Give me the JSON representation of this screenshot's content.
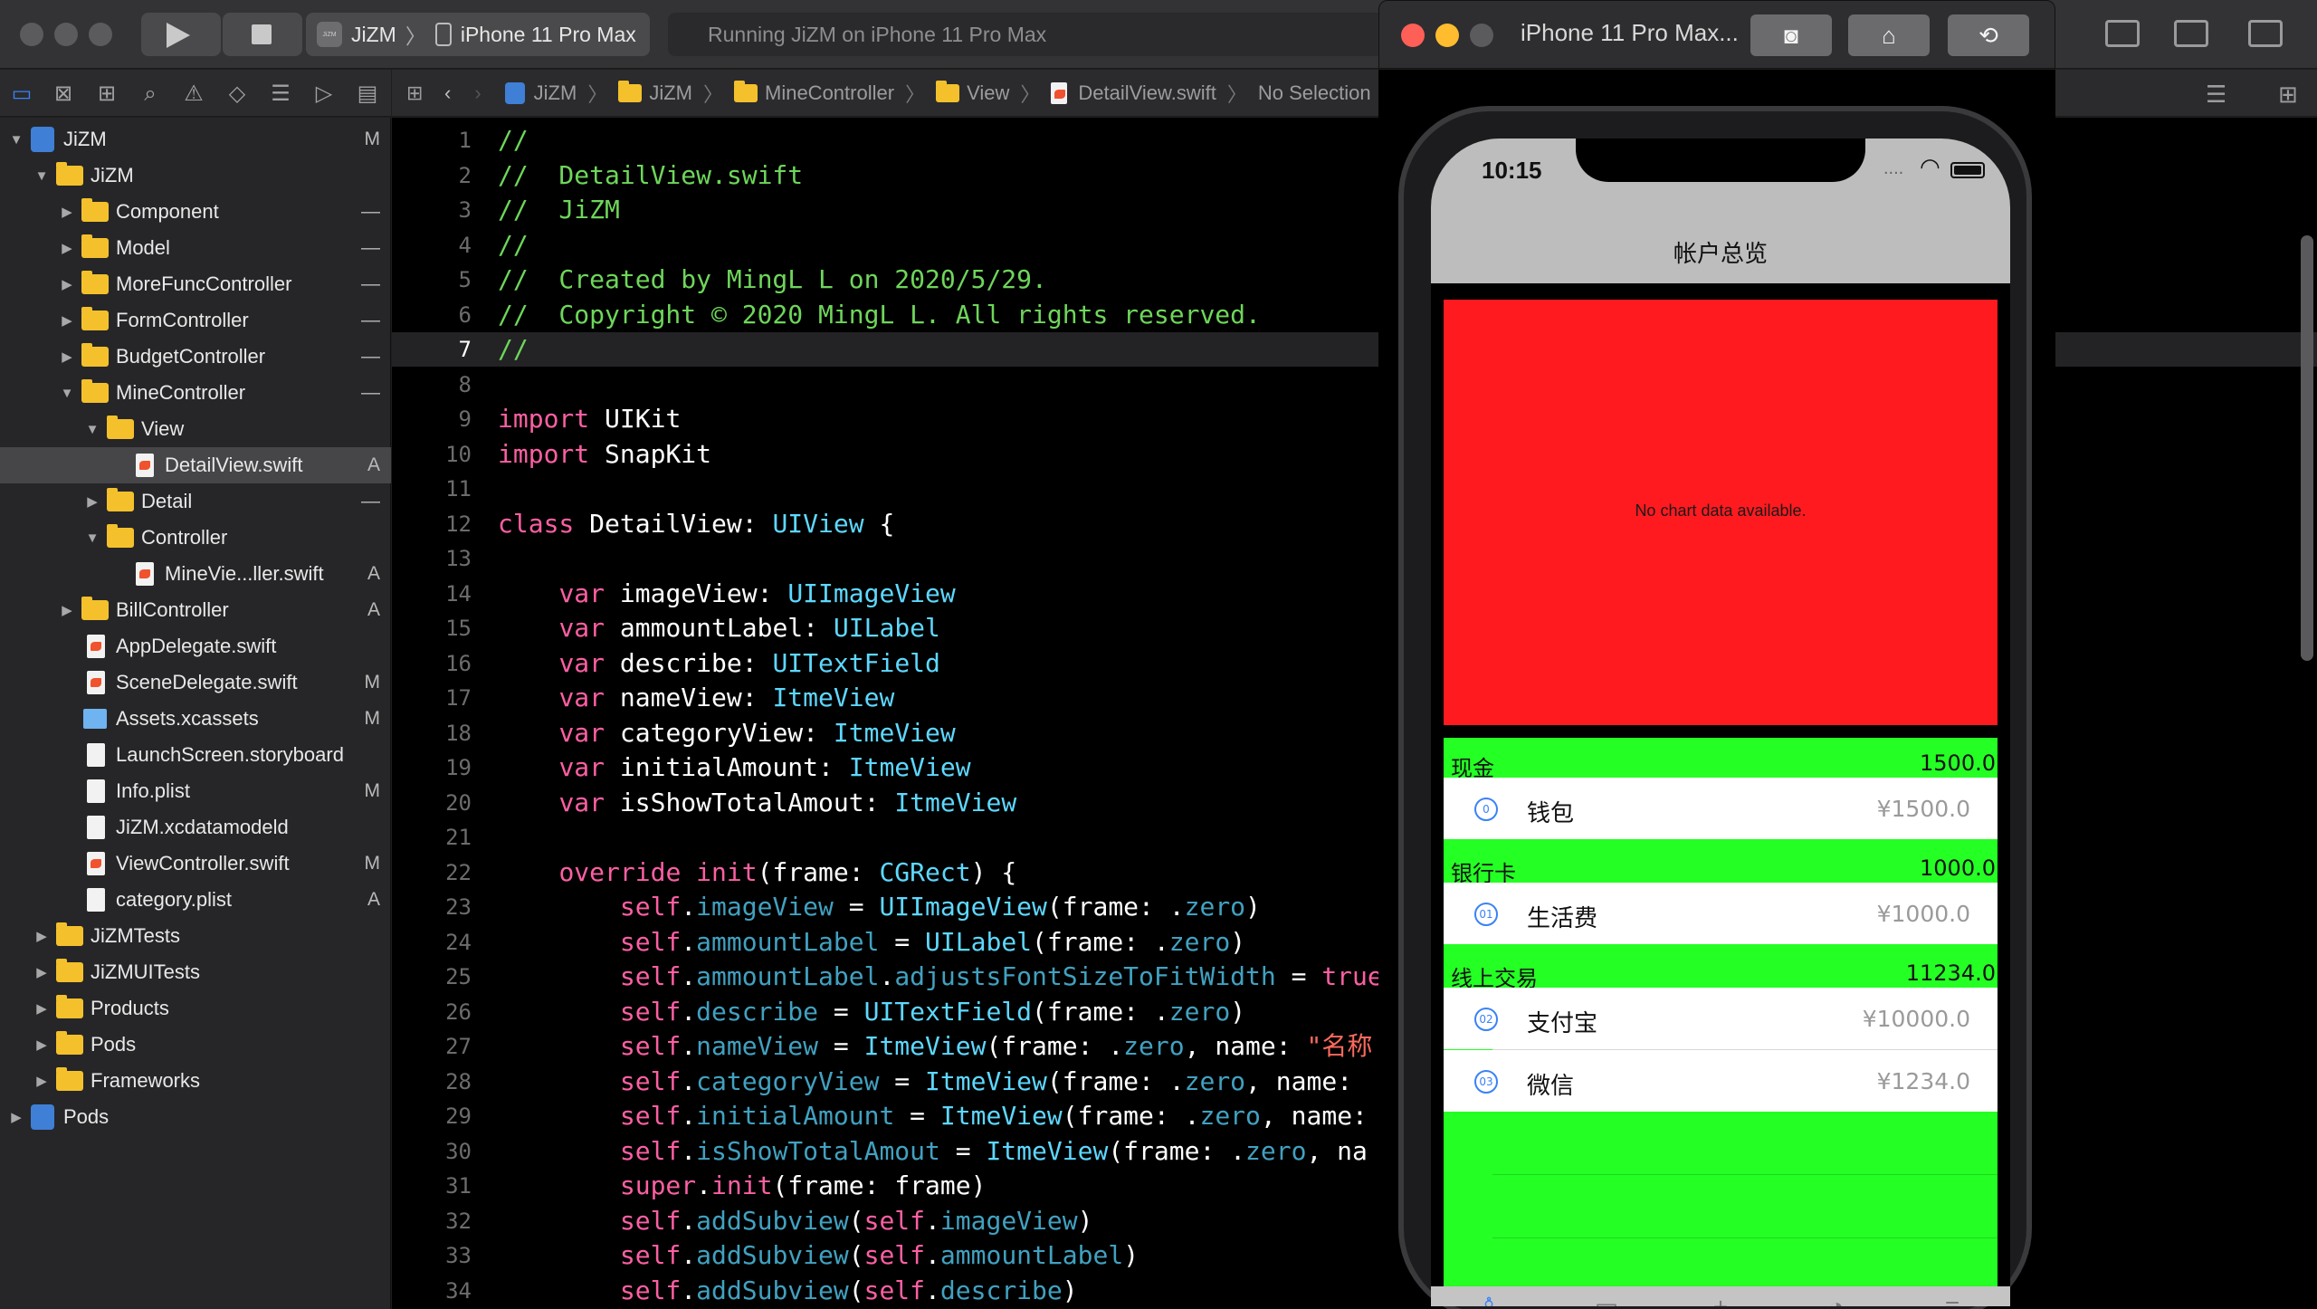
{
  "toolbar": {
    "scheme_app": "JiZM",
    "scheme_device": "iPhone 11 Pro Max",
    "activity_text": "Running JiZM on iPhone 11 Pro Max",
    "app_icon_text": "JiZM"
  },
  "navigator": {
    "items": [
      {
        "label": "JiZM",
        "status": "M"
      },
      {
        "label": "JiZM",
        "status": ""
      },
      {
        "label": "Component",
        "status": "—"
      },
      {
        "label": "Model",
        "status": "—"
      },
      {
        "label": "MoreFuncController",
        "status": "—"
      },
      {
        "label": "FormController",
        "status": "—"
      },
      {
        "label": "BudgetController",
        "status": "—"
      },
      {
        "label": "MineController",
        "status": "—"
      },
      {
        "label": "View",
        "status": ""
      },
      {
        "label": "DetailView.swift",
        "status": "A"
      },
      {
        "label": "Detail",
        "status": "—"
      },
      {
        "label": "Controller",
        "status": ""
      },
      {
        "label": "MineVie...ller.swift",
        "status": "A"
      },
      {
        "label": "BillController",
        "status": "A"
      },
      {
        "label": "AppDelegate.swift",
        "status": ""
      },
      {
        "label": "SceneDelegate.swift",
        "status": "M"
      },
      {
        "label": "Assets.xcassets",
        "status": "M"
      },
      {
        "label": "LaunchScreen.storyboard",
        "status": ""
      },
      {
        "label": "Info.plist",
        "status": "M"
      },
      {
        "label": "JiZM.xcdatamodeld",
        "status": ""
      },
      {
        "label": "ViewController.swift",
        "status": "M"
      },
      {
        "label": "category.plist",
        "status": "A"
      },
      {
        "label": "JiZMTests",
        "status": ""
      },
      {
        "label": "JiZMUITests",
        "status": ""
      },
      {
        "label": "Products",
        "status": ""
      },
      {
        "label": "Pods",
        "status": ""
      },
      {
        "label": "Frameworks",
        "status": ""
      },
      {
        "label": "Pods",
        "status": ""
      }
    ]
  },
  "jumpbar": {
    "crumbs": [
      "JiZM",
      "JiZM",
      "MineController",
      "View",
      "DetailView.swift",
      "No Selection"
    ]
  },
  "editor": {
    "current_line": 7,
    "lines": [
      {
        "n": "1",
        "t": [
          [
            "c",
            "//"
          ]
        ]
      },
      {
        "n": "2",
        "t": [
          [
            "c",
            "//  DetailView.swift"
          ]
        ]
      },
      {
        "n": "3",
        "t": [
          [
            "c",
            "//  JiZM"
          ]
        ]
      },
      {
        "n": "4",
        "t": [
          [
            "c",
            "//"
          ]
        ]
      },
      {
        "n": "5",
        "t": [
          [
            "c",
            "//  Created by MingL L on 2020/5/29."
          ]
        ]
      },
      {
        "n": "6",
        "t": [
          [
            "c",
            "//  Copyright © 2020 MingL L. All rights reserved."
          ]
        ]
      },
      {
        "n": "7",
        "t": [
          [
            "c",
            "//"
          ]
        ]
      },
      {
        "n": "8",
        "t": []
      },
      {
        "n": "9",
        "t": [
          [
            "k",
            "import"
          ],
          [
            "p",
            " UIKit"
          ]
        ]
      },
      {
        "n": "10",
        "t": [
          [
            "k",
            "import"
          ],
          [
            "p",
            " SnapKit"
          ]
        ]
      },
      {
        "n": "11",
        "t": []
      },
      {
        "n": "12",
        "t": [
          [
            "k",
            "class"
          ],
          [
            "p",
            " DetailView: "
          ],
          [
            "y",
            "UIView"
          ],
          [
            "p",
            " {"
          ]
        ]
      },
      {
        "n": "13",
        "t": []
      },
      {
        "n": "14",
        "t": [
          [
            "p",
            "    "
          ],
          [
            "k",
            "var"
          ],
          [
            "p",
            " imageView: "
          ],
          [
            "y",
            "UIImageView"
          ]
        ]
      },
      {
        "n": "15",
        "t": [
          [
            "p",
            "    "
          ],
          [
            "k",
            "var"
          ],
          [
            "p",
            " ammountLabel: "
          ],
          [
            "y",
            "UILabel"
          ]
        ]
      },
      {
        "n": "16",
        "t": [
          [
            "p",
            "    "
          ],
          [
            "k",
            "var"
          ],
          [
            "p",
            " describe: "
          ],
          [
            "y",
            "UITextField"
          ]
        ]
      },
      {
        "n": "17",
        "t": [
          [
            "p",
            "    "
          ],
          [
            "k",
            "var"
          ],
          [
            "p",
            " nameView: "
          ],
          [
            "y",
            "ItmeView"
          ]
        ]
      },
      {
        "n": "18",
        "t": [
          [
            "p",
            "    "
          ],
          [
            "k",
            "var"
          ],
          [
            "p",
            " categoryView: "
          ],
          [
            "y",
            "ItmeView"
          ]
        ]
      },
      {
        "n": "19",
        "t": [
          [
            "p",
            "    "
          ],
          [
            "k",
            "var"
          ],
          [
            "p",
            " initialAmount: "
          ],
          [
            "y",
            "ItmeView"
          ]
        ]
      },
      {
        "n": "20",
        "t": [
          [
            "p",
            "    "
          ],
          [
            "k",
            "var"
          ],
          [
            "p",
            " isShowTotalAmout: "
          ],
          [
            "y",
            "ItmeView"
          ]
        ]
      },
      {
        "n": "21",
        "t": []
      },
      {
        "n": "22",
        "t": [
          [
            "p",
            "    "
          ],
          [
            "k",
            "override"
          ],
          [
            "p",
            " "
          ],
          [
            "k",
            "init"
          ],
          [
            "p",
            "(frame: "
          ],
          [
            "y",
            "CGRect"
          ],
          [
            "p",
            ") {"
          ]
        ]
      },
      {
        "n": "23",
        "t": [
          [
            "p",
            "        "
          ],
          [
            "k",
            "self"
          ],
          [
            "p",
            "."
          ],
          [
            "r",
            "imageView"
          ],
          [
            "p",
            " = "
          ],
          [
            "y",
            "UIImageView"
          ],
          [
            "p",
            "(frame: ."
          ],
          [
            "r",
            "zero"
          ],
          [
            "p",
            ")"
          ]
        ]
      },
      {
        "n": "24",
        "t": [
          [
            "p",
            "        "
          ],
          [
            "k",
            "self"
          ],
          [
            "p",
            "."
          ],
          [
            "r",
            "ammountLabel"
          ],
          [
            "p",
            " = "
          ],
          [
            "y",
            "UILabel"
          ],
          [
            "p",
            "(frame: ."
          ],
          [
            "r",
            "zero"
          ],
          [
            "p",
            ")"
          ]
        ]
      },
      {
        "n": "25",
        "t": [
          [
            "p",
            "        "
          ],
          [
            "k",
            "self"
          ],
          [
            "p",
            "."
          ],
          [
            "r",
            "ammountLabel"
          ],
          [
            "p",
            "."
          ],
          [
            "r",
            "adjustsFontSizeToFitWidth"
          ],
          [
            "p",
            " = "
          ],
          [
            "k",
            "true"
          ]
        ]
      },
      {
        "n": "26",
        "t": [
          [
            "p",
            "        "
          ],
          [
            "k",
            "self"
          ],
          [
            "p",
            "."
          ],
          [
            "r",
            "describe"
          ],
          [
            "p",
            " = "
          ],
          [
            "y",
            "UITextField"
          ],
          [
            "p",
            "(frame: ."
          ],
          [
            "r",
            "zero"
          ],
          [
            "p",
            ")"
          ]
        ]
      },
      {
        "n": "27",
        "t": [
          [
            "p",
            "        "
          ],
          [
            "k",
            "self"
          ],
          [
            "p",
            "."
          ],
          [
            "r",
            "nameView"
          ],
          [
            "p",
            " = "
          ],
          [
            "y",
            "ItmeView"
          ],
          [
            "p",
            "(frame: ."
          ],
          [
            "r",
            "zero"
          ],
          [
            "p",
            ", name: "
          ],
          [
            "s",
            "\"名称"
          ]
        ]
      },
      {
        "n": "28",
        "t": [
          [
            "p",
            "        "
          ],
          [
            "k",
            "self"
          ],
          [
            "p",
            "."
          ],
          [
            "r",
            "categoryView"
          ],
          [
            "p",
            " = "
          ],
          [
            "y",
            "ItmeView"
          ],
          [
            "p",
            "(frame: ."
          ],
          [
            "r",
            "zero"
          ],
          [
            "p",
            ", name:"
          ]
        ]
      },
      {
        "n": "29",
        "t": [
          [
            "p",
            "        "
          ],
          [
            "k",
            "self"
          ],
          [
            "p",
            "."
          ],
          [
            "r",
            "initialAmount"
          ],
          [
            "p",
            " = "
          ],
          [
            "y",
            "ItmeView"
          ],
          [
            "p",
            "(frame: ."
          ],
          [
            "r",
            "zero"
          ],
          [
            "p",
            ", name:"
          ]
        ]
      },
      {
        "n": "30",
        "t": [
          [
            "p",
            "        "
          ],
          [
            "k",
            "self"
          ],
          [
            "p",
            "."
          ],
          [
            "r",
            "isShowTotalAmout"
          ],
          [
            "p",
            " = "
          ],
          [
            "y",
            "ItmeView"
          ],
          [
            "p",
            "(frame: ."
          ],
          [
            "r",
            "zero"
          ],
          [
            "p",
            ", na"
          ]
        ]
      },
      {
        "n": "31",
        "t": [
          [
            "p",
            "        "
          ],
          [
            "k",
            "super"
          ],
          [
            "p",
            "."
          ],
          [
            "k",
            "init"
          ],
          [
            "p",
            "(frame: frame)"
          ]
        ]
      },
      {
        "n": "32",
        "t": [
          [
            "p",
            "        "
          ],
          [
            "k",
            "self"
          ],
          [
            "p",
            "."
          ],
          [
            "r",
            "addSubview"
          ],
          [
            "p",
            "("
          ],
          [
            "k",
            "self"
          ],
          [
            "p",
            "."
          ],
          [
            "r",
            "imageView"
          ],
          [
            "p",
            ")"
          ]
        ]
      },
      {
        "n": "33",
        "t": [
          [
            "p",
            "        "
          ],
          [
            "k",
            "self"
          ],
          [
            "p",
            "."
          ],
          [
            "r",
            "addSubview"
          ],
          [
            "p",
            "("
          ],
          [
            "k",
            "self"
          ],
          [
            "p",
            "."
          ],
          [
            "r",
            "ammountLabel"
          ],
          [
            "p",
            ")"
          ]
        ]
      },
      {
        "n": "34",
        "t": [
          [
            "p",
            "        "
          ],
          [
            "k",
            "self"
          ],
          [
            "p",
            "."
          ],
          [
            "r",
            "addSubview"
          ],
          [
            "p",
            "("
          ],
          [
            "k",
            "self"
          ],
          [
            "p",
            "."
          ],
          [
            "r",
            "describe"
          ],
          [
            "p",
            ")"
          ]
        ]
      }
    ]
  },
  "simulator": {
    "title": "iPhone 11 Pro Max...",
    "time": "10:15",
    "status_dots": "....",
    "nav_title": "帐户总览",
    "chart_message": "No chart data available.",
    "sections": [
      {
        "name": "现金",
        "total": "1500.0",
        "rows": [
          {
            "badge": "0",
            "name": "钱包",
            "amount": "¥1500.0"
          }
        ]
      },
      {
        "name": "银行卡",
        "total": "1000.0",
        "rows": [
          {
            "badge": "01",
            "name": "生活费",
            "amount": "¥1000.0"
          }
        ]
      },
      {
        "name": "线上交易",
        "total": "11234.0",
        "rows": [
          {
            "badge": "02",
            "name": "支付宝",
            "amount": "¥10000.0"
          },
          {
            "badge": "03",
            "name": "微信",
            "amount": "¥1234.0"
          }
        ]
      }
    ],
    "tabs": [
      {
        "icon": "person-icon",
        "glyph": "♙"
      },
      {
        "icon": "card-icon",
        "glyph": "▭"
      },
      {
        "icon": "plus-icon",
        "glyph": "+"
      },
      {
        "icon": "pie-chart-icon",
        "glyph": "◔"
      },
      {
        "icon": "sliders-icon",
        "glyph": "≡"
      }
    ],
    "colors": {
      "chart_bg": "#ff1a1f",
      "list_bg": "#24ff24",
      "accent": "#3a82f7"
    }
  }
}
